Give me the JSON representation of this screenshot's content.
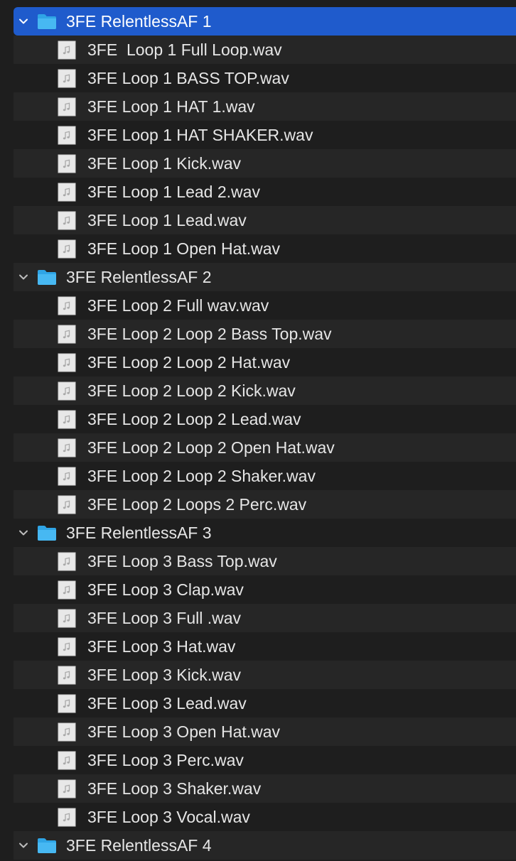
{
  "colors": {
    "background": "#1e1e1e",
    "row_alt": "#262626",
    "selection": "#1f5bcc",
    "text": "#e6e6e6",
    "folder_blue": "#2fa5e6"
  },
  "icons": {
    "folder": "folder-icon",
    "file": "audio-file-icon",
    "disclosure": "chevron-down-icon"
  },
  "folders": [
    {
      "name": "3FE RelentlessAF 1",
      "selected": true,
      "expanded": true,
      "files": [
        "3FE  Loop 1 Full Loop.wav",
        "3FE Loop 1 BASS TOP.wav",
        "3FE Loop 1 HAT 1.wav",
        "3FE Loop 1 HAT SHAKER.wav",
        "3FE Loop 1 Kick.wav",
        "3FE Loop 1 Lead 2.wav",
        "3FE Loop 1 Lead.wav",
        "3FE Loop 1 Open Hat.wav"
      ]
    },
    {
      "name": "3FE RelentlessAF 2",
      "selected": false,
      "expanded": true,
      "files": [
        "3FE Loop 2 Full wav.wav",
        "3FE Loop 2 Loop 2 Bass Top.wav",
        "3FE Loop 2 Loop 2 Hat.wav",
        "3FE Loop 2 Loop 2 Kick.wav",
        "3FE Loop 2 Loop 2 Lead.wav",
        "3FE Loop 2 Loop 2 Open Hat.wav",
        "3FE Loop 2 Loop 2 Shaker.wav",
        "3FE Loop 2 Loops 2 Perc.wav"
      ]
    },
    {
      "name": "3FE RelentlessAF 3",
      "selected": false,
      "expanded": true,
      "files": [
        "3FE Loop 3 Bass Top.wav",
        "3FE Loop 3 Clap.wav",
        "3FE Loop 3 Full .wav",
        "3FE Loop 3 Hat.wav",
        "3FE Loop 3 Kick.wav",
        "3FE Loop 3 Lead.wav",
        "3FE Loop 3 Open Hat.wav",
        "3FE Loop 3 Perc.wav",
        "3FE Loop 3 Shaker.wav",
        "3FE Loop 3 Vocal.wav"
      ]
    },
    {
      "name": "3FE RelentlessAF 4",
      "selected": false,
      "expanded": true,
      "files": []
    }
  ]
}
